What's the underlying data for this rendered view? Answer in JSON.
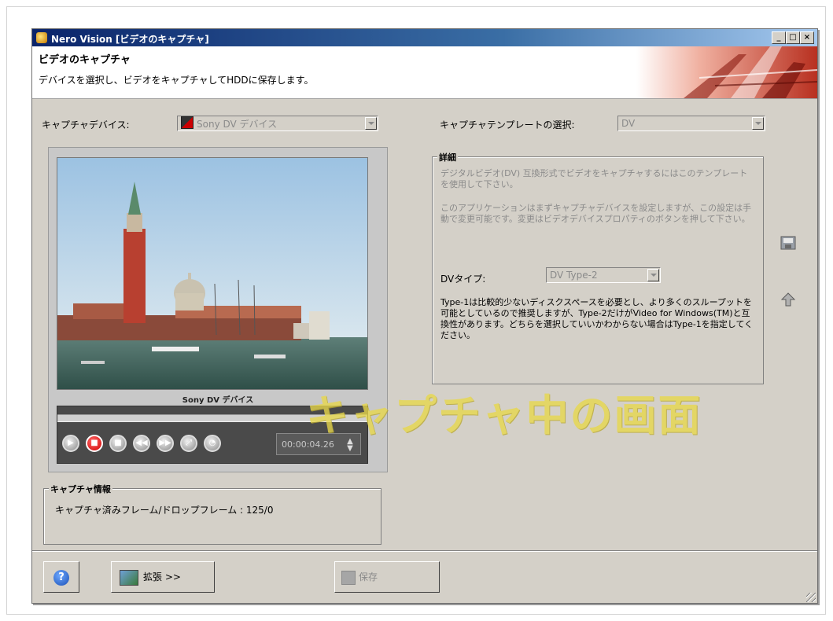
{
  "window": {
    "title": "Nero Vision [ビデオのキャプチャ]",
    "min_glyph": "_",
    "max_glyph": "□",
    "close_glyph": "×"
  },
  "header": {
    "title": "ビデオのキャプチャ",
    "subtitle": "デバイスを選択し、ビデオをキャプチャしてHDDに保存します。"
  },
  "capture_device": {
    "label": "キャプチャデバイス:",
    "value": "Sony DV デバイス"
  },
  "template": {
    "label": "キャプチャテンプレートの選択:",
    "value": "DV"
  },
  "details": {
    "title": "詳細",
    "text1": "デジタルビデオ(DV) 互換形式でビデオをキャプチャするにはこのテンプレートを使用して下さい。",
    "text2": "このアプリケーションはまずキャプチャデバイスを設定しますが、この設定は手動で変更可能です。変更はビデオデバイスプロパティのボタンを押して下さい。",
    "dv_type_label": "DVタイプ:",
    "dv_type_value": "DV Type-2",
    "dv_note": "Type-1は比較的少ないディスクスペースを必要とし、より多くのスループットを可能としているので推奨しますが、Type-2だけがVideo for Windows(TM)と互換性があります。どちらを選択していいかわからない場合はType-1を指定してください。"
  },
  "preview": {
    "caption": "Sony DV デバイス",
    "timecode": "00:00:04.26",
    "spin_up": "▲",
    "spin_down": "▼"
  },
  "capture_info": {
    "title": "キャプチャ情報",
    "text": "キャプチャ済みフレーム/ドロップフレーム : 125/0"
  },
  "buttons": {
    "help_glyph": "?",
    "extend": "拡張 >>",
    "save": "保存"
  },
  "overlay": "キャプチャ中の画面"
}
